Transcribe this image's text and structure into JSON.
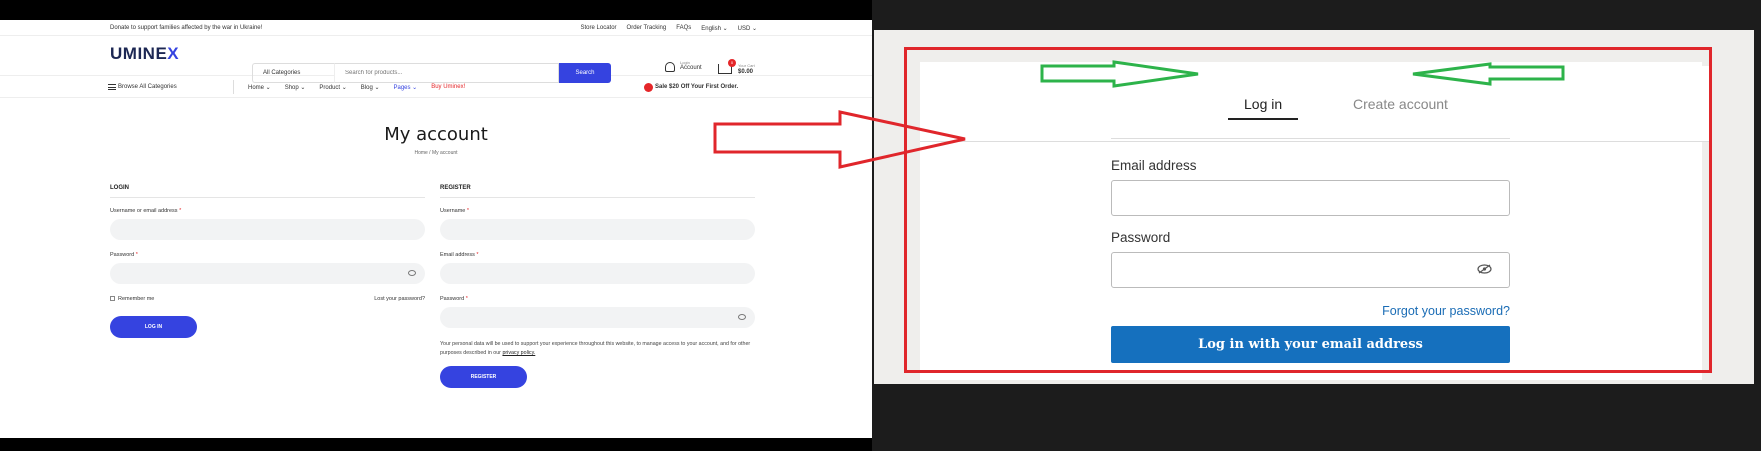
{
  "left": {
    "topbar": {
      "donate": "Donate to support families affected by the war in Ukraine!",
      "links": [
        "Store Locator",
        "Order Tracking",
        "FAQs",
        "English ⌄",
        "USD ⌄"
      ]
    },
    "header": {
      "logo_main": "UMINE",
      "logo_x": "X",
      "category_select": "All Categories",
      "search_placeholder": "Search for products...",
      "search_button": "Search",
      "account_small": "Login",
      "account_label": "Account",
      "cart_small": "Your Cart",
      "cart_total": "$0.00",
      "cart_count": "0"
    },
    "nav": {
      "browse": "Browse All Categories",
      "items": [
        "Home ⌄",
        "Shop ⌄",
        "Product ⌄",
        "Blog ⌄",
        "Pages ⌄",
        "Buy Uminex!"
      ],
      "sale": "Sale $20 Off Your First Order."
    },
    "page_title": "My account",
    "breadcrumb": "Home  /  My account",
    "login": {
      "heading": "LOGIN",
      "username_label": "Username or email address",
      "password_label": "Password",
      "remember": "Remember me",
      "lost": "Lost your password?",
      "button": "LOG IN"
    },
    "register": {
      "heading": "REGISTER",
      "username_label": "Username",
      "email_label": "Email address",
      "password_label": "Password",
      "privacy_text": "Your personal data will be used to support your experience throughout this website, to manage access to your account, and for other purposes described in our",
      "privacy_link": "privacy policy.",
      "button": "REGISTER"
    },
    "required_mark": "*"
  },
  "right": {
    "tab_login": "Log in",
    "tab_create": "Create account",
    "email_label": "Email address",
    "password_label": "Password",
    "forgot": "Forgot your password?",
    "submit": "Log in with your email address"
  },
  "colors": {
    "brand_blue": "#3543e0",
    "annotation_red": "#e0262b",
    "annotation_green": "#2db34a",
    "submit_blue": "#1570be"
  }
}
